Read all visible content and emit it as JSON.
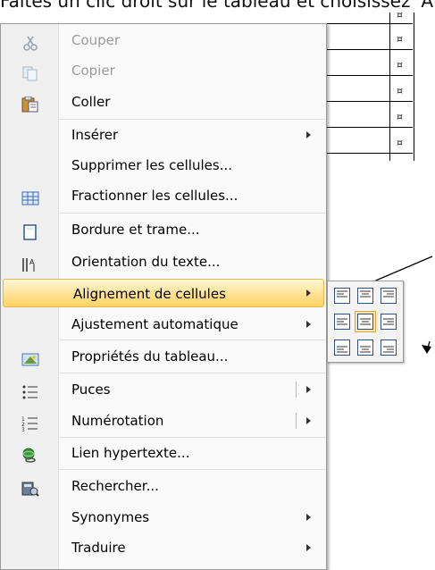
{
  "doc": {
    "top_text": "Faites un clic droit sur le tableau et choisissez 'A",
    "cell_mark": "¤"
  },
  "menu": {
    "items": [
      {
        "label": "Couper",
        "icon": "scissors-icon",
        "disabled": true
      },
      {
        "label": "Copier",
        "icon": "copy-icon",
        "disabled": true
      },
      {
        "label": "Coller",
        "icon": "paste-icon"
      },
      {
        "label": "Insérer",
        "submenu": true
      },
      {
        "label": "Supprimer les cellules..."
      },
      {
        "label": "Fractionner les cellules...",
        "icon": "split-cells-icon"
      },
      {
        "label": "Bordure et trame...",
        "icon": "border-icon"
      },
      {
        "label": "Orientation du texte...",
        "icon": "text-direction-icon"
      },
      {
        "label": "Alignement de cellules",
        "submenu": true,
        "highlighted": true
      },
      {
        "label": "Ajustement automatique",
        "submenu": true
      },
      {
        "label": "Propriétés du tableau...",
        "icon": "table-properties-icon"
      },
      {
        "label": "Puces",
        "icon": "bullets-icon",
        "split": true
      },
      {
        "label": "Numérotation",
        "icon": "numbering-icon",
        "split": true
      },
      {
        "label": "Lien hypertexte...",
        "icon": "hyperlink-icon"
      },
      {
        "label": "Rechercher...",
        "icon": "research-icon"
      },
      {
        "label": "Synonymes",
        "submenu": true
      },
      {
        "label": "Traduire",
        "submenu": true
      }
    ]
  },
  "colors": {
    "highlight": "#ffd262",
    "menu_bg": "#fafafa",
    "gutter": "#f0f0f0"
  }
}
